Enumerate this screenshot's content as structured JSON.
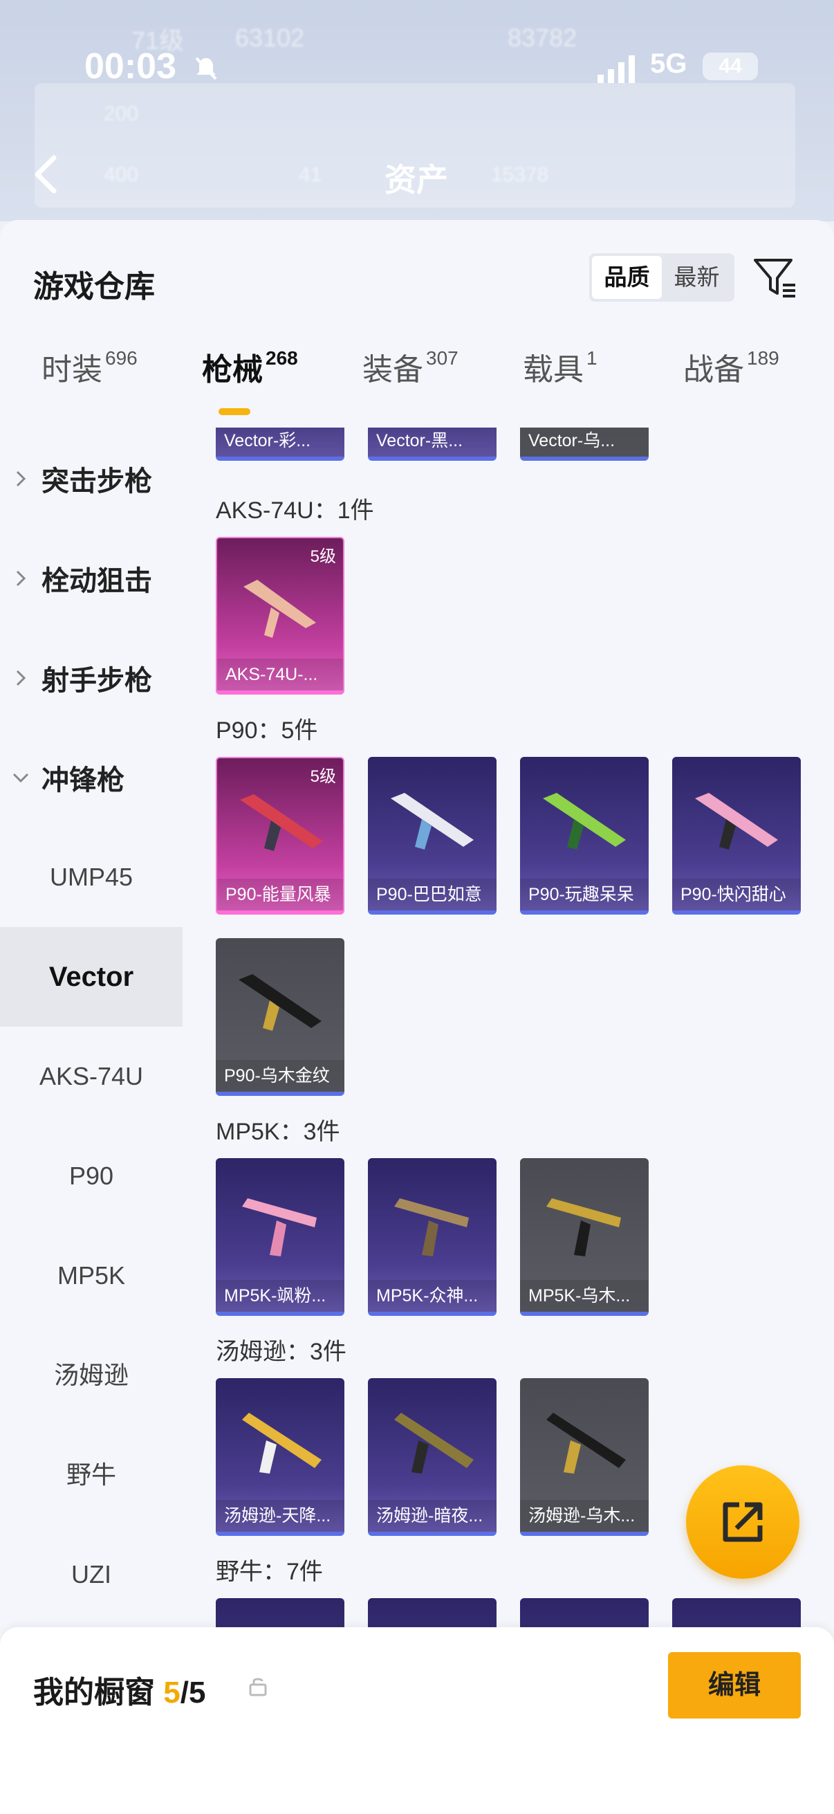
{
  "status": {
    "time": "00:03",
    "network": "5G",
    "battery": "44"
  },
  "nav": {
    "title": "资产"
  },
  "background_ghost": {
    "level": "71级",
    "coins": "63102",
    "score": "83782",
    "a": "200",
    "b": "400",
    "c": "41",
    "d": "15378"
  },
  "header": {
    "title": "游戏仓库",
    "sort_quality": "品质",
    "sort_latest": "最新"
  },
  "tabs": [
    {
      "label": "时装",
      "count": "696"
    },
    {
      "label": "枪械",
      "count": "268"
    },
    {
      "label": "装备",
      "count": "307"
    },
    {
      "label": "载具",
      "count": "1"
    },
    {
      "label": "战备",
      "count": "189"
    }
  ],
  "sidebar": {
    "categories": [
      "突击步枪",
      "栓动狙击",
      "射手步枪",
      "冲锋枪"
    ],
    "subitems": [
      "UMP45",
      "Vector",
      "AKS-74U",
      "P90",
      "MP5K",
      "汤姆逊",
      "野牛",
      "UZI"
    ]
  },
  "groups": {
    "vector": {
      "items": [
        "Vector-彩...",
        "Vector-黑...",
        "Vector-乌..."
      ]
    },
    "aks": {
      "label": "AKS-74U：1件",
      "items": [
        {
          "name": "AKS-74U-...",
          "level": "5级"
        }
      ]
    },
    "p90": {
      "label": "P90：5件",
      "items": [
        {
          "name": "P90-能量风暴",
          "level": "5级"
        },
        {
          "name": "P90-巴巴如意"
        },
        {
          "name": "P90-玩趣呆呆"
        },
        {
          "name": "P90-快闪甜心"
        },
        {
          "name": "P90-乌木金纹"
        }
      ]
    },
    "mp5k": {
      "label": "MP5K：3件",
      "items": [
        "MP5K-飒粉...",
        "MP5K-众神...",
        "MP5K-乌木..."
      ]
    },
    "thompson": {
      "label": "汤姆逊：3件",
      "items": [
        "汤姆逊-天降...",
        "汤姆逊-暗夜...",
        "汤姆逊-乌木..."
      ]
    },
    "bison": {
      "label": "野牛：7件"
    }
  },
  "showcase": {
    "label": "我的橱窗",
    "current": "5",
    "sep": "/",
    "total": "5",
    "edit": "编辑"
  },
  "colors": {
    "accent": "#f8a90d",
    "rare_pink": "#c23f9f",
    "epic_purple": "#4b3d8f",
    "common_gray": "#5c5d64"
  }
}
